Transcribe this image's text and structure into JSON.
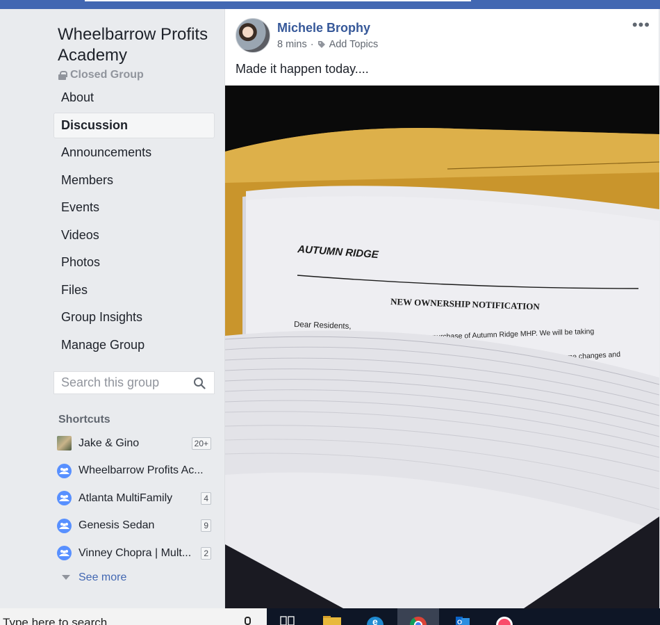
{
  "group": {
    "title": "Wheelbarrow Profits Academy",
    "privacy": "Closed Group"
  },
  "nav": {
    "items": [
      {
        "label": "About"
      },
      {
        "label": "Discussion"
      },
      {
        "label": "Announcements"
      },
      {
        "label": "Members"
      },
      {
        "label": "Events"
      },
      {
        "label": "Videos"
      },
      {
        "label": "Photos"
      },
      {
        "label": "Files"
      },
      {
        "label": "Group Insights"
      },
      {
        "label": "Manage Group"
      }
    ],
    "active": "Discussion"
  },
  "search": {
    "placeholder": "Search this group",
    "icon": "search-icon"
  },
  "shortcuts": {
    "title": "Shortcuts",
    "items": [
      {
        "label": "Jake & Gino",
        "count": "20+"
      },
      {
        "label": "Wheelbarrow Profits Ac...",
        "count": ""
      },
      {
        "label": "Atlanta MultiFamily",
        "count": "4"
      },
      {
        "label": "Genesis Sedan",
        "count": "9"
      },
      {
        "label": "Vinney Chopra | Mult...",
        "count": "2"
      }
    ],
    "see_more": "See more"
  },
  "post": {
    "author": "Michele Brophy",
    "time": "8 mins",
    "separator": "·",
    "add_topics": "Add Topics",
    "text": "Made it happen today....",
    "photo": {
      "heading": "AUTUMN RIDGE",
      "subheading": "NEW OWNERSHIP NOTIFICATION",
      "greeting": "Dear Residents,",
      "line1": "This is a letter of introduction regarding our purchase of Autumn Ridge MHP.  We will be taking",
      "line2": "f 5/31/2018.  You will be seeing some changes and"
    }
  },
  "taskbar": {
    "search_text": "Type here to search"
  },
  "colors": {
    "brand": "#4267b2",
    "link": "#365899",
    "sidebar_bg": "#e9ebee",
    "group_icon": "#5890ff"
  }
}
